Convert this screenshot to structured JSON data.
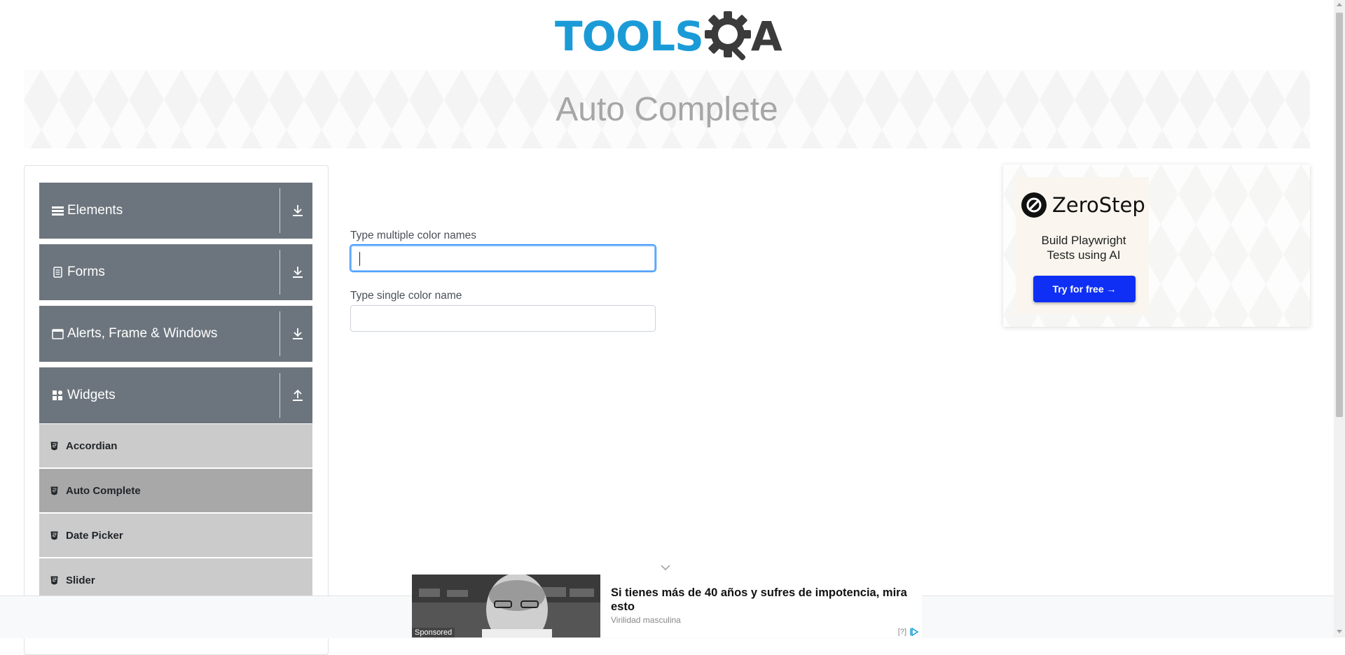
{
  "header": {
    "logo_tools": "TOOLS",
    "logo_a": "A"
  },
  "banner": {
    "title": "Auto Complete"
  },
  "sidebar": {
    "groups": [
      {
        "label": "Elements",
        "icon": "hamburger-icon",
        "toggle": "download-icon"
      },
      {
        "label": "Forms",
        "icon": "document-icon",
        "toggle": "download-icon"
      },
      {
        "label": "Alerts, Frame & Windows",
        "icon": "window-icon",
        "toggle": "download-icon"
      },
      {
        "label": "Widgets",
        "icon": "widgets-icon",
        "toggle": "upload-icon"
      }
    ],
    "items": [
      {
        "label": "Accordian",
        "active": false
      },
      {
        "label": "Auto Complete",
        "active": true
      },
      {
        "label": "Date Picker",
        "active": false
      },
      {
        "label": "Slider",
        "active": false
      }
    ]
  },
  "form": {
    "multiple_label": "Type multiple color names",
    "multiple_value": "",
    "single_label": "Type single color name",
    "single_value": ""
  },
  "ad_right": {
    "brand": "ZeroStep",
    "tagline_line1": "Build Playwright",
    "tagline_line2": "Tests using AI",
    "button": "Try for free →",
    "button_color": "#0f2ff5"
  },
  "ad_bottom": {
    "sponsored": "Sponsored",
    "headline": "Si tienes más de 40 años y sufres de impotencia, mira esto",
    "source": "Virilidad masculina",
    "choices": "[?]"
  },
  "colors": {
    "sidebar_header": "#6c757d",
    "sidebar_item": "#cbcbcb",
    "sidebar_item_active": "#a8a8a8",
    "logo_blue": "#1a9bd7"
  }
}
